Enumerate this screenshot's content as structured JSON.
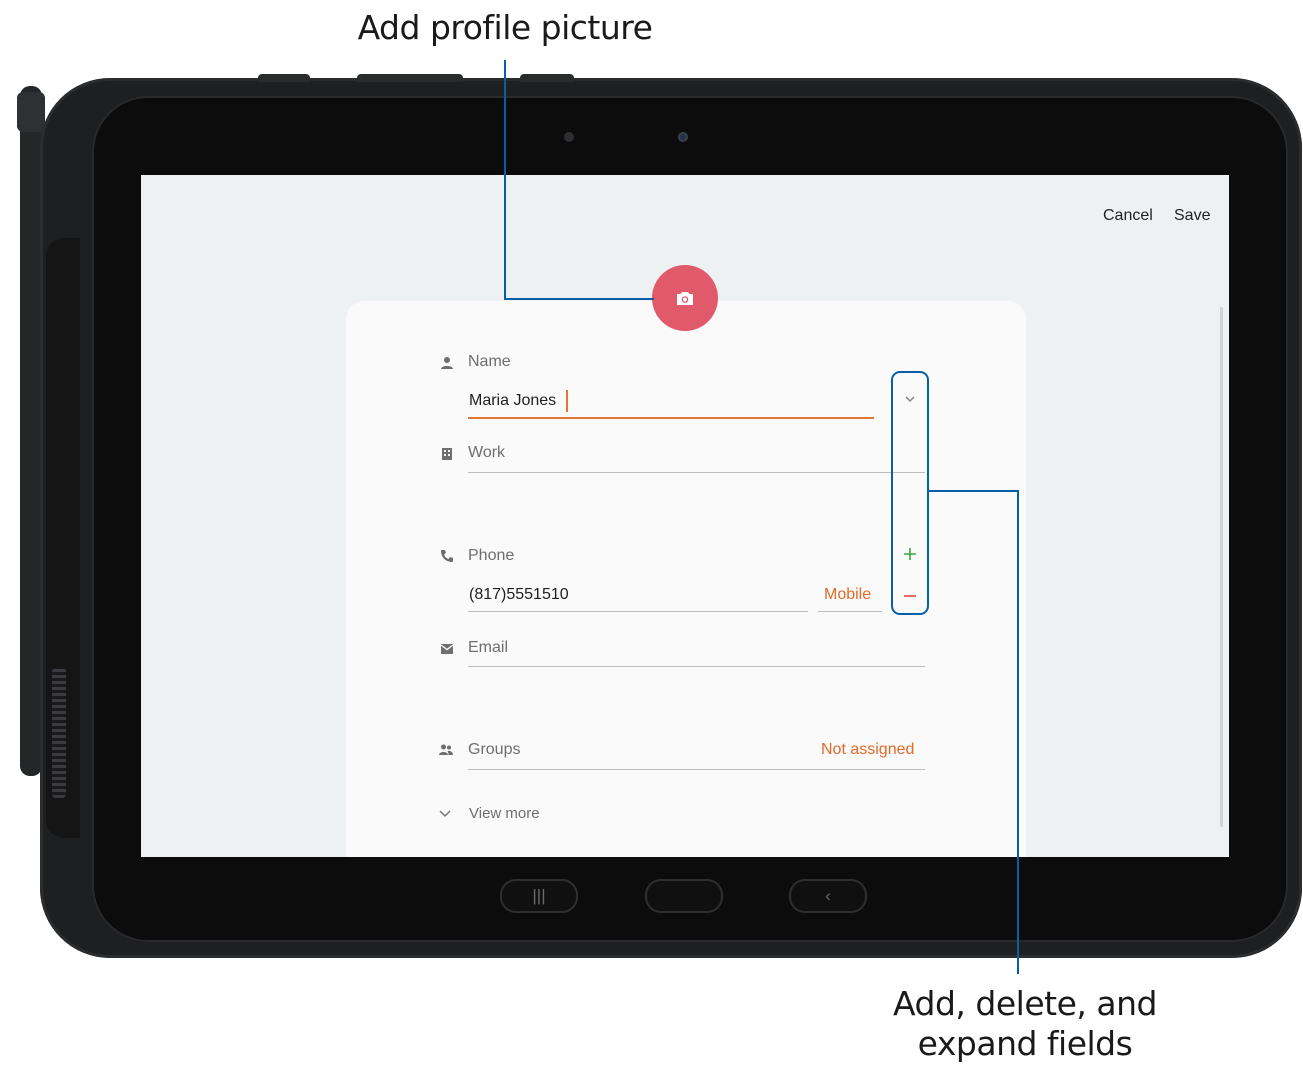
{
  "callouts": {
    "top": "Add profile picture",
    "bottom_line1": "Add, delete, and",
    "bottom_line2": "expand fields"
  },
  "topbar": {
    "cancel_label": "Cancel",
    "save_label": "Save"
  },
  "form": {
    "name": {
      "label": "Name",
      "value": "Maria Jones",
      "icon": "person-icon"
    },
    "work": {
      "label": "Work",
      "icon": "building-icon"
    },
    "phone": {
      "label": "Phone",
      "value": "(817)5551510",
      "type": "Mobile",
      "icon": "phone-icon"
    },
    "email": {
      "label": "Email",
      "icon": "envelope-icon"
    },
    "groups": {
      "label": "Groups",
      "value": "Not assigned",
      "icon": "group-icon"
    },
    "view_more": "View more"
  },
  "navbar": {
    "recents": "|||",
    "back": "‹"
  },
  "colors": {
    "accent_orange": "#e06a28",
    "avatar_red": "#e05a6c",
    "callout_blue": "#0a5ea8",
    "add_green": "#3aa83a",
    "remove_red": "#e0453a"
  }
}
